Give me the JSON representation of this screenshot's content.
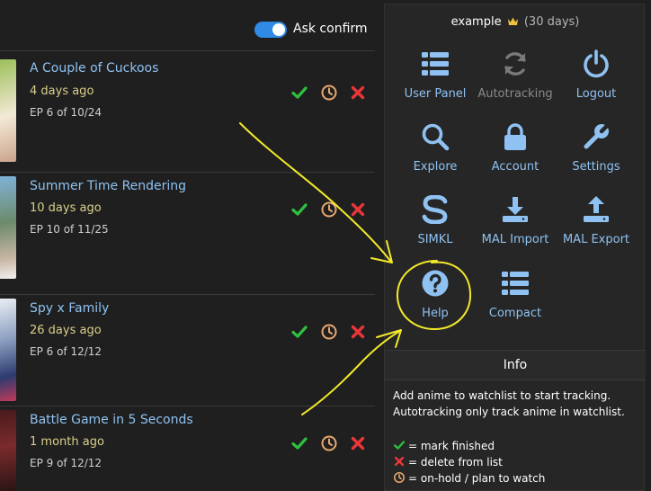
{
  "header": {
    "ask_confirm_label": "Ask confirm",
    "ask_confirm_on": true
  },
  "entries": [
    {
      "title": "A Couple of Cuckoos",
      "ago": "4 days ago",
      "episode": "EP 6 of 10/24"
    },
    {
      "title": "Summer Time Rendering",
      "ago": "10 days ago",
      "episode": "EP 10 of 11/25"
    },
    {
      "title": "Spy x Family",
      "ago": "26 days ago",
      "episode": "EP 6 of 12/12"
    },
    {
      "title": "Battle Game in 5 Seconds",
      "ago": "1 month ago",
      "episode": "EP 9 of 12/12"
    }
  ],
  "menu": {
    "username": "example",
    "crown_icon": "crown-icon",
    "subscription": "(30 days)",
    "tiles": [
      {
        "label": "User Panel",
        "icon": "list-icon"
      },
      {
        "label": "Autotracking",
        "icon": "sync-icon"
      },
      {
        "label": "Logout",
        "icon": "power-icon"
      },
      {
        "label": "Explore",
        "icon": "search-icon"
      },
      {
        "label": "Account",
        "icon": "lock-icon"
      },
      {
        "label": "Settings",
        "icon": "wrench-icon"
      },
      {
        "label": "SIMKL",
        "icon": "simkl-logo-icon"
      },
      {
        "label": "MAL Import",
        "icon": "download-icon"
      },
      {
        "label": "MAL Export",
        "icon": "upload-icon"
      },
      {
        "label": "Help",
        "icon": "question-icon"
      },
      {
        "label": "Compact",
        "icon": "list-icon"
      }
    ],
    "info": {
      "heading": "Info",
      "line1": "Add anime to watchlist to start tracking.",
      "line2": "Autotracking only track anime in watchlist.",
      "legend_finished": "= mark finished",
      "legend_delete": "= delete from list",
      "legend_hold": "= on-hold / plan to watch"
    }
  },
  "colors": {
    "accent": "#8fc2f2",
    "check": "#2fbf3f",
    "clock": "#e8a870",
    "delete": "#e8363a",
    "annotation": "#f2ea2a"
  }
}
